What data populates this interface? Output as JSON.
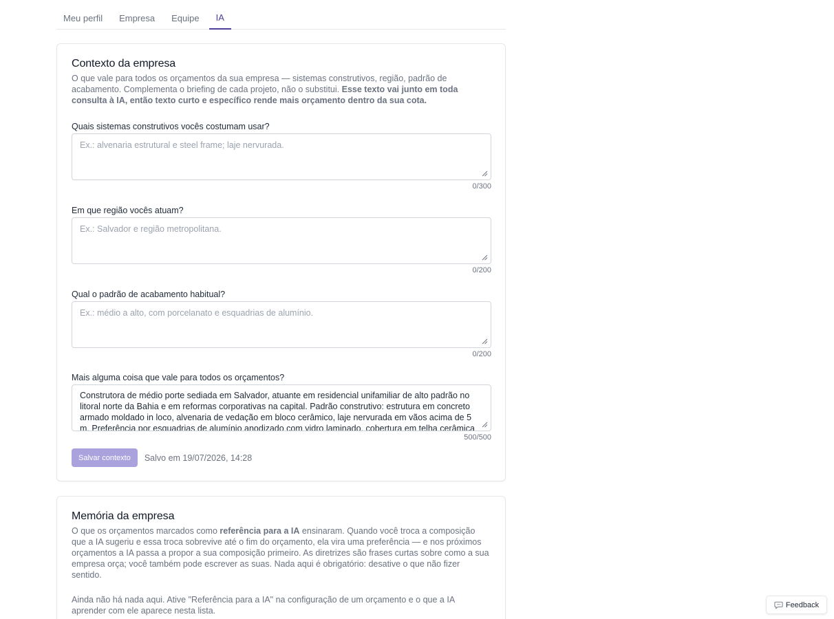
{
  "tabs": [
    {
      "label": "Meu perfil",
      "active": false
    },
    {
      "label": "Empresa",
      "active": false
    },
    {
      "label": "Equipe",
      "active": false
    },
    {
      "label": "IA",
      "active": true
    }
  ],
  "context_card": {
    "title": "Contexto da empresa",
    "description_plain": "O que vale para todos os orçamentos da sua empresa — sistemas construtivos, região, padrão de acabamento. Complementa o briefing de cada projeto, não o substitui. ",
    "description_bold": "Esse texto vai junto em toda consulta à IA, então texto curto e específico rende mais orçamento dentro da sua cota.",
    "fields": [
      {
        "label": "Quais sistemas construtivos vocês costumam usar?",
        "placeholder": "Ex.: alvenaria estrutural e steel frame; laje nervurada.",
        "value": "",
        "counter": "0/300"
      },
      {
        "label": "Em que região vocês atuam?",
        "placeholder": "Ex.: Salvador e região metropolitana.",
        "value": "",
        "counter": "0/200"
      },
      {
        "label": "Qual o padrão de acabamento habitual?",
        "placeholder": "Ex.: médio a alto, com porcelanato e esquadrias de alumínio.",
        "value": "",
        "counter": "0/200"
      },
      {
        "label": "Mais alguma coisa que vale para todos os orçamentos?",
        "placeholder": "",
        "value": "Construtora de médio porte sediada em Salvador, atuante em residencial unifamiliar de alto padrão no litoral norte da Bahia e em reformas corporativas na capital. Padrão construtivo: estrutura em concreto armado moldado in loco, alvenaria de vedação em bloco cerâmico, laje nervurada em vãos acima de 5 m. Preferência por esquadrias de alumínio anodizado com vidro laminado, cobertura em telha cerâmica",
        "counter": "500/500"
      }
    ],
    "save_button": "Salvar contexto",
    "saved_status": "Salvo em 19/07/2026, 14:28"
  },
  "memory_card": {
    "title": "Memória da empresa",
    "description_pre": "O que os orçamentos marcados como ",
    "description_bold": "referência para a IA",
    "description_post": " ensinaram. Quando você troca a composição que a IA sugeriu e essa troca sobrevive até o fim do orçamento, ela vira uma preferência — e nos próximos orçamentos a IA passa a propor a sua composição primeiro. As diretrizes são frases curtas sobre como a sua empresa orça; você também pode escrever as suas. Nada aqui é obrigatório: desative o que não fizer sentido.",
    "empty_text": "Ainda não há nada aqui. Ative \"Referência para a IA\" na configuração de um orçamento e o que a IA aprender com ele aparece nesta lista."
  },
  "feedback": {
    "label": "Feedback",
    "icon": "chat-bubble-icon"
  },
  "colors": {
    "accent": "#4c3f99",
    "button_disabled": "#a9a2dc"
  }
}
